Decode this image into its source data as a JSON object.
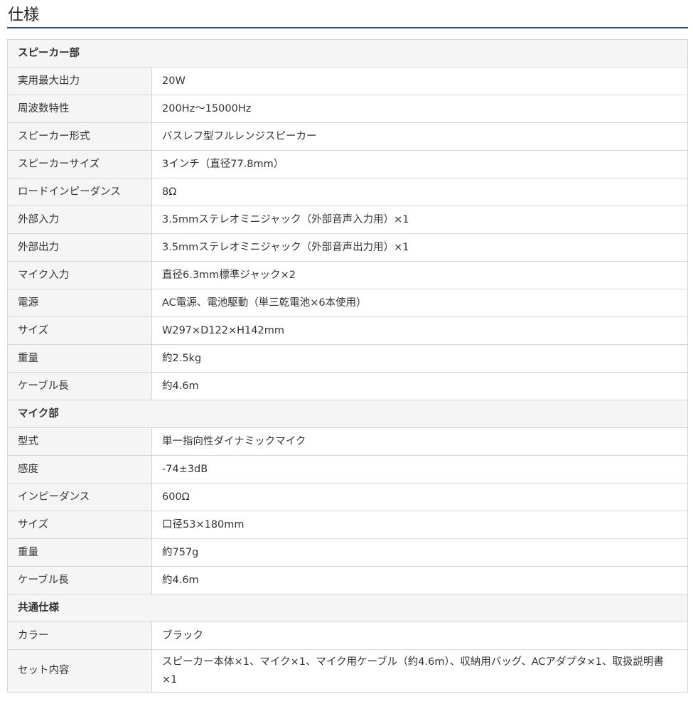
{
  "title": "仕様",
  "sections": [
    {
      "heading": "スピーカー部",
      "rows": [
        {
          "label": "実用最大出力",
          "value": "20W"
        },
        {
          "label": "周波数特性",
          "value": "200Hz～15000Hz"
        },
        {
          "label": "スピーカー形式",
          "value": "バスレフ型フルレンジスピーカー"
        },
        {
          "label": "スピーカーサイズ",
          "value": "3インチ（直径77.8mm）"
        },
        {
          "label": "ロードインピーダンス",
          "value": "8Ω"
        },
        {
          "label": "外部入力",
          "value": "3.5mmステレオミニジャック（外部音声入力用）×1"
        },
        {
          "label": "外部出力",
          "value": "3.5mmステレオミニジャック（外部音声出力用）×1"
        },
        {
          "label": "マイク入力",
          "value": "直径6.3mm標準ジャック×2"
        },
        {
          "label": "電源",
          "value": "AC電源、電池駆動（単三乾電池×6本使用）"
        },
        {
          "label": "サイズ",
          "value": "W297×D122×H142mm"
        },
        {
          "label": "重量",
          "value": "約2.5kg"
        },
        {
          "label": "ケーブル長",
          "value": "約4.6m"
        }
      ]
    },
    {
      "heading": "マイク部",
      "rows": [
        {
          "label": "型式",
          "value": "単一指向性ダイナミックマイク"
        },
        {
          "label": "感度",
          "value": "-74±3dB"
        },
        {
          "label": "インピーダンス",
          "value": "600Ω"
        },
        {
          "label": "サイズ",
          "value": "口径53×180mm"
        },
        {
          "label": "重量",
          "value": "約757g"
        },
        {
          "label": "ケーブル長",
          "value": "約4.6m"
        }
      ]
    },
    {
      "heading": "共通仕様",
      "rows": [
        {
          "label": "カラー",
          "value": "ブラック"
        },
        {
          "label": "セット内容",
          "value": "スピーカー本体×1、マイク×1、マイク用ケーブル（約4.6m）、収納用バッグ、ACアダプタ×1、取扱説明書×1"
        }
      ]
    }
  ]
}
